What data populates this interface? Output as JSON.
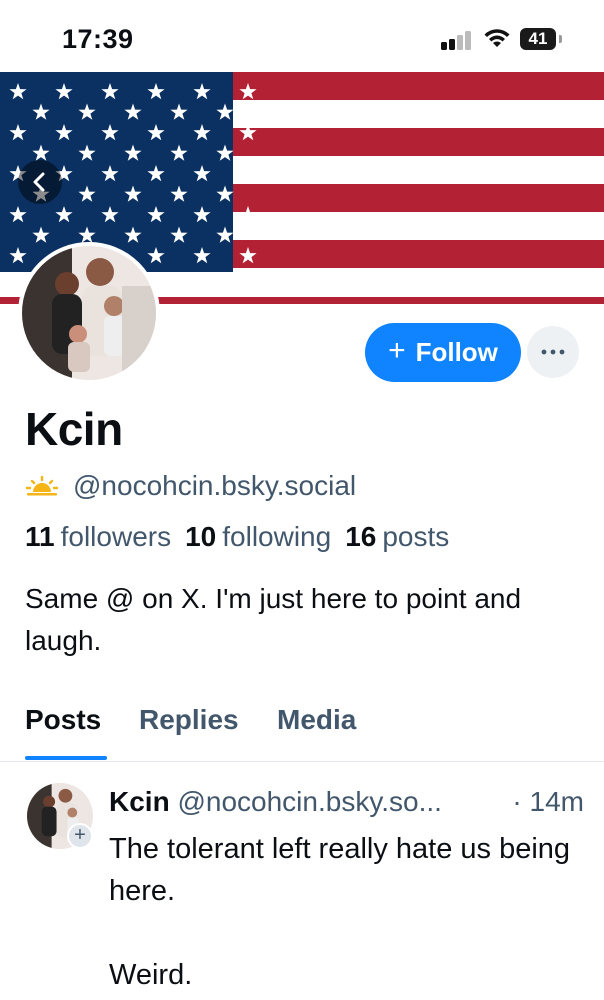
{
  "status_bar": {
    "time": "17:39",
    "battery": "41"
  },
  "banner": {
    "flag": "us-flag"
  },
  "profile": {
    "display_name": "Kcin",
    "handle": "@nocohcin.bsky.social",
    "badge_icon": "sunrise-icon",
    "followers_count": "11",
    "followers_label": "followers",
    "following_count": "10",
    "following_label": "following",
    "posts_count": "16",
    "posts_label": "posts",
    "bio": "Same @ on X. I'm just here to point and laugh."
  },
  "actions": {
    "follow_plus": "+",
    "follow_label": "Follow",
    "more_icon": "ellipsis-icon"
  },
  "tabs": [
    {
      "label": "Posts",
      "active": true
    },
    {
      "label": "Replies",
      "active": false
    },
    {
      "label": "Media",
      "active": false
    }
  ],
  "post": {
    "author": "Kcin",
    "handle": "@nocohcin.bsky.so...",
    "time": "· 14m",
    "text": "The tolerant left really hate us being here.\n\nWeird."
  },
  "colors": {
    "accent": "#1083fe",
    "muted": "#42576c",
    "flag_red": "#b22234",
    "flag_blue": "#0a3161"
  }
}
